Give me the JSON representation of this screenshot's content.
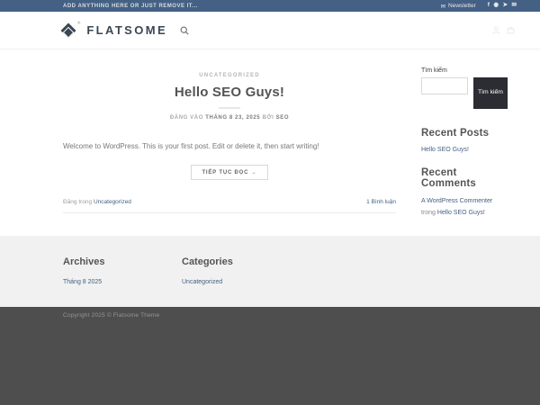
{
  "colors": {
    "primary": "#446084",
    "topbar_bg": "#446084",
    "logo": "#3b4653",
    "link": "#446084",
    "search_button_bg": "#2c2c33",
    "footer_light_bg": "#f1f1f1",
    "footer_dark_bg": "#4e4e4e"
  },
  "topbar": {
    "left_text": "ADD ANYTHING HERE OR JUST REMOVE IT...",
    "newsletter_label": "Newsletter",
    "newsletter_icon_glyph": "✉",
    "social_icons": [
      {
        "name": "facebook",
        "glyph": "f"
      },
      {
        "name": "instagram",
        "glyph": "◉"
      },
      {
        "name": "twitter",
        "glyph": "➤"
      },
      {
        "name": "email",
        "glyph": "✉"
      }
    ]
  },
  "header": {
    "logo_text": "FLATSOME",
    "registered_mark": "®"
  },
  "post": {
    "category": "UNCATEGORIZED",
    "title": "Hello SEO Guys!",
    "meta_prefix": "ĐĂNG VÀO ",
    "meta_date": "THÁNG 8 23, 2025",
    "meta_by": " BỞI ",
    "meta_author": "SEO",
    "excerpt": "Welcome to WordPress. This is your first post. Edit or delete it, then start writing!",
    "read_more_label": "TIẾP TỤC ĐỌC →",
    "posted_in_text": "Đăng trong ",
    "posted_in_category": "Uncategorized",
    "comments_link": "1 Bình luận"
  },
  "sidebar": {
    "search": {
      "label": "Tìm kiếm",
      "input_value": "",
      "button_label": "Tìm kiếm"
    },
    "recent_posts": {
      "title": "Recent Posts",
      "items": [
        "Hello SEO Guys!"
      ]
    },
    "recent_comments": {
      "title": "Recent Comments",
      "items": [
        {
          "author": "A WordPress Commenter",
          "connector": " trong ",
          "post": "Hello SEO Guys!"
        }
      ]
    }
  },
  "footer": {
    "columns": [
      {
        "title": "Archives",
        "links": [
          "Tháng 8 2025"
        ]
      },
      {
        "title": "Categories",
        "links": [
          "Uncategorized"
        ]
      }
    ],
    "copyright": "Copyright 2025 © Flatsome Theme"
  }
}
